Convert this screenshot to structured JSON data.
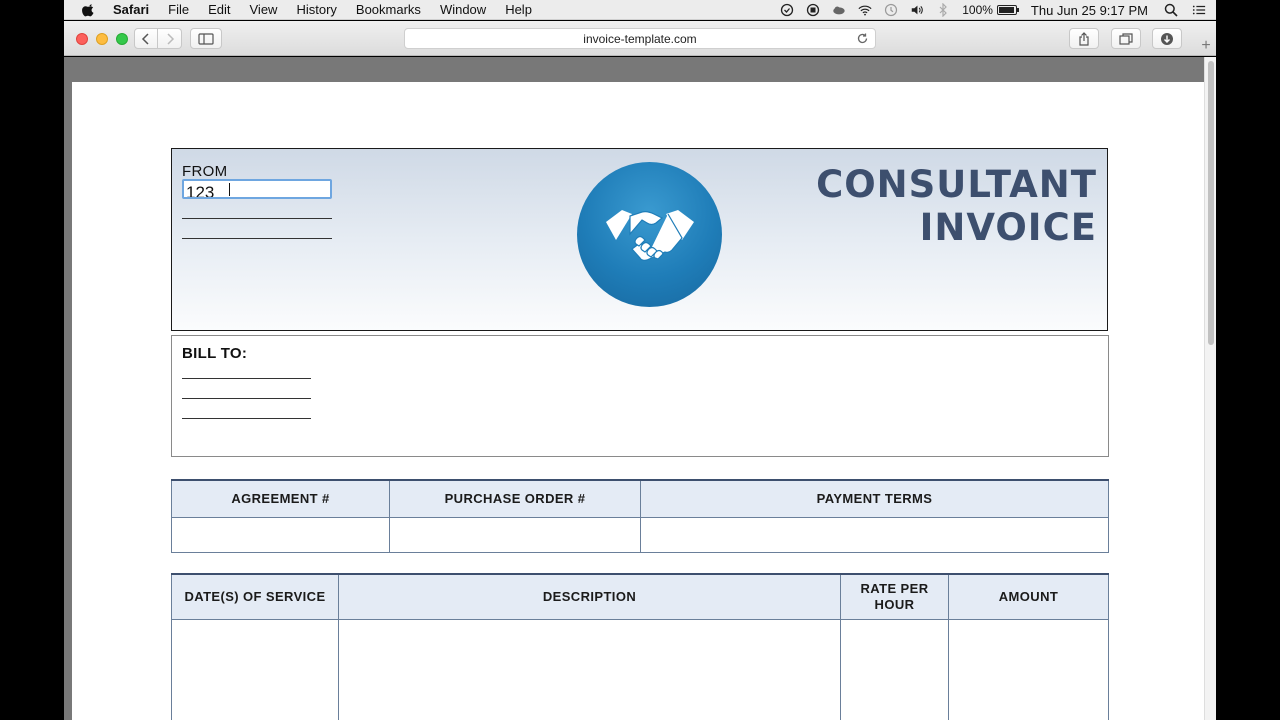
{
  "menubar": {
    "app_name": "Safari",
    "items": [
      "File",
      "Edit",
      "View",
      "History",
      "Bookmarks",
      "Window",
      "Help"
    ],
    "battery": "100%",
    "clock": "Thu Jun 25  9:17 PM"
  },
  "browser": {
    "url": "invoice-template.com"
  },
  "invoice": {
    "from_label": "FROM",
    "from_input_value": "123",
    "title_line1": "CONSULTANT",
    "title_line2": "INVOICE",
    "bill_to_label": "BILL TO:",
    "terms_headers": [
      "AGREEMENT #",
      "PURCHASE ORDER #",
      "PAYMENT TERMS"
    ],
    "service_headers": [
      "DATE(S) OF SERVICE",
      "DESCRIPTION",
      "RATE PER HOUR",
      "AMOUNT"
    ]
  },
  "colors": {
    "title": "#3d4f6e",
    "logo": "#1f7db8",
    "header_cell": "#e4ebf5"
  }
}
